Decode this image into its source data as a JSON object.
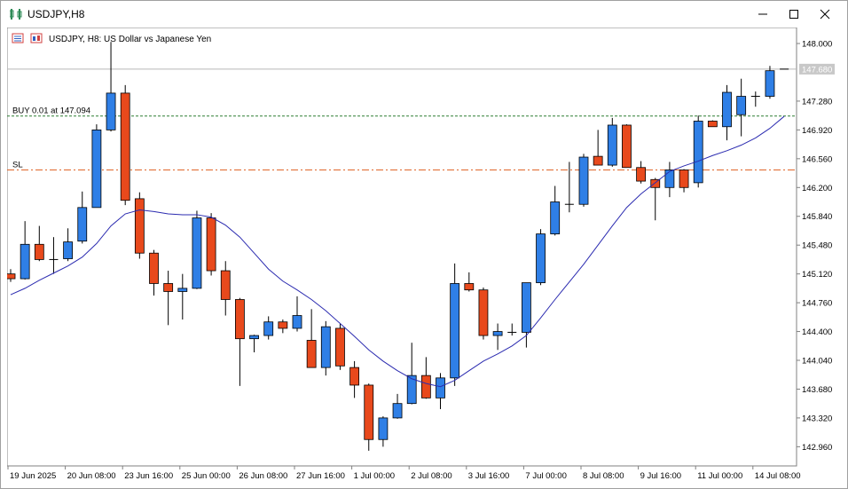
{
  "window": {
    "title": "USDJPY,H8",
    "minimize_icon": "minimize-icon",
    "maximize_icon": "maximize-icon",
    "close_icon": "close-icon"
  },
  "chart_header": {
    "text": "USDJPY, H8:  US Dollar vs Japanese Yen"
  },
  "trade_lines": {
    "buy_label": "BUY 0.01 at 147.094",
    "buy_price": 147.094,
    "sl_label": "SL",
    "sl_price": 146.42,
    "buy_color": "#2e7d32",
    "sl_color": "#e0662a"
  },
  "chart_data": {
    "type": "candlestick",
    "symbol": "USDJPY",
    "timeframe": "H8",
    "current_price": 147.68,
    "current_price_label": "147.680",
    "ylim": [
      142.72,
      148.2
    ],
    "y_ticks": [
      "148.000",
      "147.280",
      "146.920",
      "146.560",
      "146.200",
      "145.840",
      "145.480",
      "145.120",
      "144.760",
      "144.400",
      "144.040",
      "143.680",
      "143.320",
      "142.960"
    ],
    "x_labels": [
      "19 Jun 2025",
      "20 Jun 08:00",
      "23 Jun 16:00",
      "25 Jun 00:00",
      "26 Jun 08:00",
      "27 Jun 16:00",
      "1 Jul 00:00",
      "2 Jul 08:00",
      "3 Jul 16:00",
      "7 Jul 00:00",
      "8 Jul 08:00",
      "9 Jul 16:00",
      "11 Jul 00:00",
      "14 Jul 08:00"
    ],
    "x_label_bars": [
      0,
      4,
      8,
      12,
      16,
      20,
      24,
      28,
      32,
      36,
      40,
      44,
      48,
      52
    ],
    "up_color": "#2f7fe6",
    "down_color": "#e8491c",
    "ma_color": "#2b2bb0",
    "candles": [
      {
        "o": 145.12,
        "h": 145.18,
        "l": 145.02,
        "c": 145.06
      },
      {
        "o": 145.06,
        "h": 145.78,
        "l": 145.05,
        "c": 145.49
      },
      {
        "o": 145.49,
        "h": 145.72,
        "l": 145.28,
        "c": 145.3
      },
      {
        "o": 145.3,
        "h": 145.58,
        "l": 145.12,
        "c": 145.3
      },
      {
        "o": 145.31,
        "h": 145.69,
        "l": 145.28,
        "c": 145.52
      },
      {
        "o": 145.53,
        "h": 146.15,
        "l": 145.5,
        "c": 145.95
      },
      {
        "o": 145.95,
        "h": 146.99,
        "l": 146.14,
        "c": 146.92
      },
      {
        "o": 146.92,
        "h": 148.02,
        "l": 146.9,
        "c": 147.38
      },
      {
        "o": 147.38,
        "h": 147.48,
        "l": 145.98,
        "c": 146.04
      },
      {
        "o": 146.06,
        "h": 146.14,
        "l": 145.31,
        "c": 145.38
      },
      {
        "o": 145.38,
        "h": 145.42,
        "l": 144.85,
        "c": 145.0
      },
      {
        "o": 145.0,
        "h": 145.16,
        "l": 144.48,
        "c": 144.9
      },
      {
        "o": 144.9,
        "h": 145.12,
        "l": 144.55,
        "c": 144.94
      },
      {
        "o": 144.94,
        "h": 145.91,
        "l": 144.93,
        "c": 145.82
      },
      {
        "o": 145.82,
        "h": 145.88,
        "l": 145.1,
        "c": 145.16
      },
      {
        "o": 145.16,
        "h": 145.28,
        "l": 144.6,
        "c": 144.8
      },
      {
        "o": 144.8,
        "h": 144.82,
        "l": 143.72,
        "c": 144.31
      },
      {
        "o": 144.31,
        "h": 144.36,
        "l": 144.14,
        "c": 144.35
      },
      {
        "o": 144.35,
        "h": 144.59,
        "l": 144.3,
        "c": 144.52
      },
      {
        "o": 144.52,
        "h": 144.55,
        "l": 144.38,
        "c": 144.44
      },
      {
        "o": 144.44,
        "h": 144.84,
        "l": 144.4,
        "c": 144.6
      },
      {
        "o": 144.29,
        "h": 144.68,
        "l": 144.0,
        "c": 143.95
      },
      {
        "o": 143.95,
        "h": 144.53,
        "l": 143.85,
        "c": 144.46
      },
      {
        "o": 144.44,
        "h": 144.5,
        "l": 143.92,
        "c": 143.97
      },
      {
        "o": 143.95,
        "h": 144.03,
        "l": 143.57,
        "c": 143.73
      },
      {
        "o": 143.73,
        "h": 143.75,
        "l": 142.91,
        "c": 143.05
      },
      {
        "o": 143.05,
        "h": 143.34,
        "l": 142.96,
        "c": 143.32
      },
      {
        "o": 143.32,
        "h": 143.62,
        "l": 143.31,
        "c": 143.5
      },
      {
        "o": 143.5,
        "h": 144.26,
        "l": 143.49,
        "c": 143.85
      },
      {
        "o": 143.85,
        "h": 144.08,
        "l": 143.56,
        "c": 143.57
      },
      {
        "o": 143.57,
        "h": 143.88,
        "l": 143.43,
        "c": 143.82
      },
      {
        "o": 143.82,
        "h": 145.25,
        "l": 143.72,
        "c": 145.0
      },
      {
        "o": 145.0,
        "h": 145.14,
        "l": 144.9,
        "c": 144.92
      },
      {
        "o": 144.92,
        "h": 144.95,
        "l": 144.3,
        "c": 144.35
      },
      {
        "o": 144.35,
        "h": 144.5,
        "l": 144.17,
        "c": 144.4
      },
      {
        "o": 144.38,
        "h": 144.5,
        "l": 144.35,
        "c": 144.39
      },
      {
        "o": 144.39,
        "h": 145.01,
        "l": 144.2,
        "c": 145.01
      },
      {
        "o": 145.01,
        "h": 145.68,
        "l": 144.98,
        "c": 145.62
      },
      {
        "o": 145.62,
        "h": 146.22,
        "l": 145.6,
        "c": 146.02
      },
      {
        "o": 145.98,
        "h": 146.52,
        "l": 145.89,
        "c": 145.99
      },
      {
        "o": 145.99,
        "h": 146.62,
        "l": 145.96,
        "c": 146.58
      },
      {
        "o": 146.59,
        "h": 146.92,
        "l": 146.48,
        "c": 146.48
      },
      {
        "o": 146.48,
        "h": 147.07,
        "l": 146.46,
        "c": 146.98
      },
      {
        "o": 146.98,
        "h": 146.99,
        "l": 146.46,
        "c": 146.45
      },
      {
        "o": 146.45,
        "h": 146.53,
        "l": 146.25,
        "c": 146.28
      },
      {
        "o": 146.3,
        "h": 146.32,
        "l": 145.79,
        "c": 146.2
      },
      {
        "o": 146.2,
        "h": 146.52,
        "l": 146.08,
        "c": 146.42
      },
      {
        "o": 146.42,
        "h": 146.43,
        "l": 146.14,
        "c": 146.2
      },
      {
        "o": 146.26,
        "h": 147.1,
        "l": 146.2,
        "c": 147.03
      },
      {
        "o": 147.03,
        "h": 147.04,
        "l": 146.97,
        "c": 146.96
      },
      {
        "o": 146.96,
        "h": 147.48,
        "l": 146.79,
        "c": 147.39
      },
      {
        "o": 147.11,
        "h": 147.56,
        "l": 146.84,
        "c": 147.34
      },
      {
        "o": 147.33,
        "h": 147.4,
        "l": 147.21,
        "c": 147.34
      },
      {
        "o": 147.34,
        "h": 147.72,
        "l": 147.31,
        "c": 147.66
      },
      {
        "o": 147.68,
        "h": 147.68,
        "l": 147.68,
        "c": 147.68
      }
    ],
    "ma": [
      144.86,
      144.94,
      145.04,
      145.13,
      145.22,
      145.33,
      145.5,
      145.72,
      145.87,
      145.92,
      145.9,
      145.87,
      145.86,
      145.86,
      145.83,
      145.73,
      145.58,
      145.38,
      145.18,
      145.03,
      144.92,
      144.8,
      144.66,
      144.5,
      144.34,
      144.17,
      144.03,
      143.91,
      143.81,
      143.75,
      143.71,
      143.79,
      143.91,
      144.03,
      144.12,
      144.22,
      144.35,
      144.57,
      144.8,
      145.02,
      145.24,
      145.48,
      145.72,
      145.95,
      146.12,
      146.26,
      146.4,
      146.47,
      146.53,
      146.6,
      146.66,
      146.73,
      146.82,
      146.94,
      147.09
    ]
  }
}
